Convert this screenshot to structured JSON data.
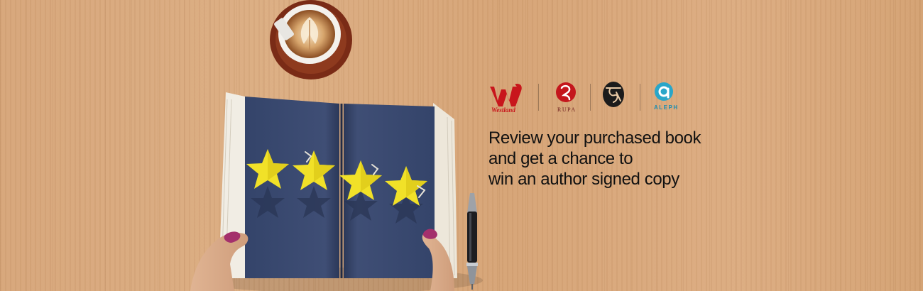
{
  "promo": {
    "headline_lines": [
      "Review your purchased book",
      "and get a chance to",
      "win an author signed copy"
    ],
    "rating_stars": 4
  },
  "brands": {
    "westland": {
      "mark": "W",
      "label": "Westland"
    },
    "rupa": {
      "label": "RUPA"
    },
    "third": {
      "name": "script-mark-logo"
    },
    "aleph": {
      "label": "ALEPH"
    }
  },
  "colors": {
    "wood": "#d9a97c",
    "book_page": "#3b4a6e",
    "star": "#f1e128",
    "westland_red": "#c8161c",
    "rupa_red": "#c4161c",
    "aleph_blue": "#1f8db0",
    "headline_text": "#111111"
  },
  "icons": [
    "coffee-cup-icon",
    "star-icon",
    "pen-icon",
    "westland-logo",
    "rupa-logo",
    "script-logo",
    "aleph-logo"
  ]
}
